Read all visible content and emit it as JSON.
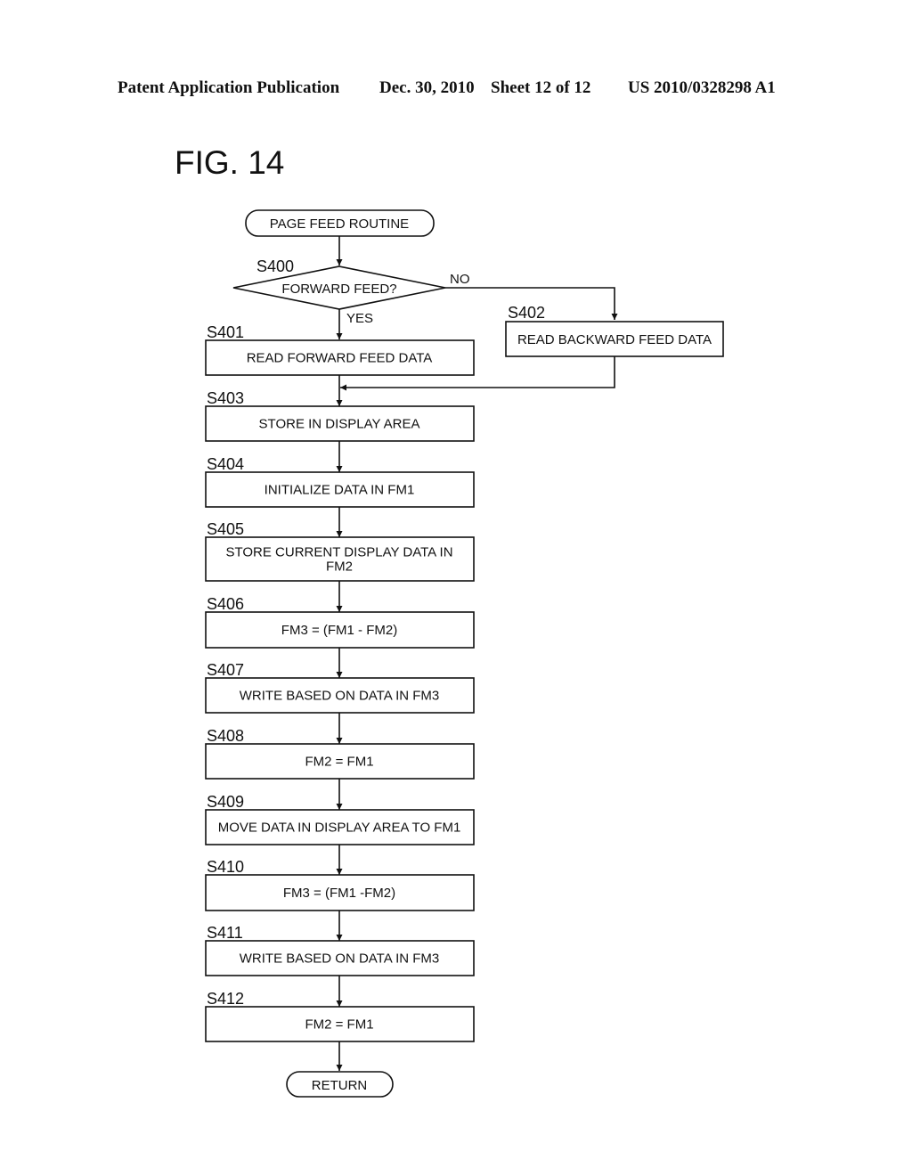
{
  "header": {
    "publication": "Patent Application Publication",
    "date": "Dec. 30, 2010",
    "sheet": "Sheet 12 of 12",
    "number": "US 2010/0328298 A1"
  },
  "figure": {
    "title": "FIG. 14"
  },
  "flowchart": {
    "start": {
      "label": "PAGE FEED ROUTINE"
    },
    "decision": {
      "step": "S400",
      "label": "FORWARD FEED?",
      "yes_label": "YES",
      "no_label": "NO"
    },
    "branch_no": {
      "step": "S402",
      "label": "READ BACKWARD FEED DATA"
    },
    "steps": [
      {
        "step": "S401",
        "lines": [
          "READ FORWARD FEED DATA"
        ]
      },
      {
        "step": "S403",
        "lines": [
          "STORE IN DISPLAY AREA"
        ]
      },
      {
        "step": "S404",
        "lines": [
          "INITIALIZE DATA IN FM1"
        ]
      },
      {
        "step": "S405",
        "lines": [
          "STORE CURRENT DISPLAY DATA IN",
          "FM2"
        ]
      },
      {
        "step": "S406",
        "lines": [
          "FM3 = (FM1 - FM2)"
        ]
      },
      {
        "step": "S407",
        "lines": [
          "WRITE BASED ON DATA IN FM3"
        ]
      },
      {
        "step": "S408",
        "lines": [
          "FM2 = FM1"
        ]
      },
      {
        "step": "S409",
        "lines": [
          "MOVE DATA IN DISPLAY AREA TO FM1"
        ]
      },
      {
        "step": "S410",
        "lines": [
          "FM3 = (FM1 -FM2)"
        ]
      },
      {
        "step": "S411",
        "lines": [
          "WRITE BASED ON DATA IN FM3"
        ]
      },
      {
        "step": "S412",
        "lines": [
          "FM2 = FM1"
        ]
      }
    ],
    "end": {
      "label": "RETURN"
    }
  }
}
